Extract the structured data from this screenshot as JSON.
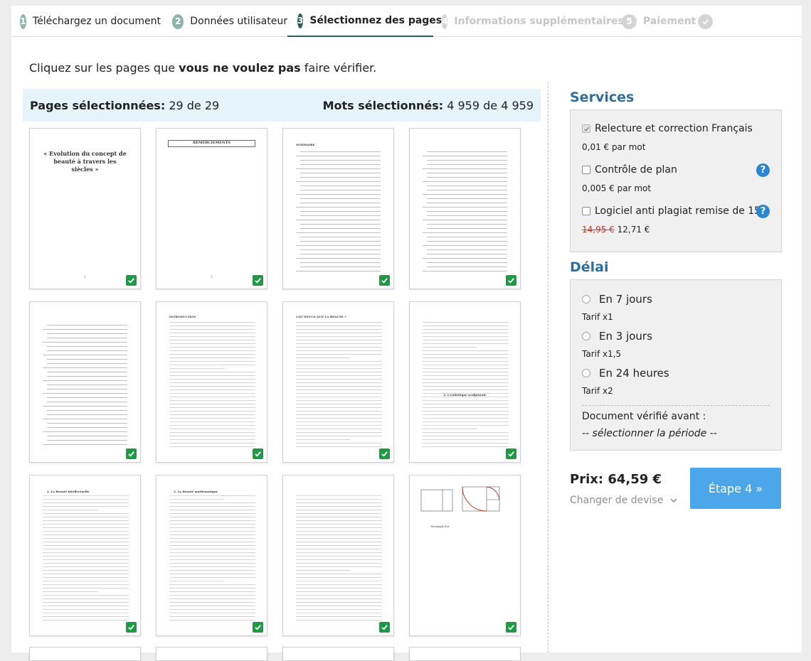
{
  "stepper": {
    "steps": [
      {
        "num": "1",
        "label": "Téléchargez un document"
      },
      {
        "num": "2",
        "label": "Données utilisateur"
      },
      {
        "num": "3",
        "label": "Sélectionnez des pages"
      },
      {
        "num": "4",
        "label": "Informations supplémentaires"
      },
      {
        "num": "5",
        "label": "Paiement"
      }
    ],
    "done_icon": "check-circle-icon"
  },
  "instruction": {
    "prefix": "Cliquez sur les pages que ",
    "bold": "vous ne voulez pas",
    "suffix": " faire vérifier."
  },
  "summary": {
    "pages_label": "Pages sélectionnées:",
    "pages_value": "29 de 29",
    "words_label": "Mots sélectionnés:",
    "words_value": "4 959 de 4 959"
  },
  "pages": {
    "cover_title": "« Evolution du concept de beauté à travers les siècles »",
    "p2_heading": "REMERCIEMENTS",
    "p3_heading": "SOMMAIRE",
    "p6_heading": "INTRODUCTION",
    "p7_heading": "I.QU'EST-CE QUE LA BEAUTE ?",
    "p8_heading": "2. L'esthétique sculpturale",
    "p9_heading": "2. La Beauté intellectuelle",
    "p10_heading": "3. La Beauté mathématique",
    "p12_caption": "Rectangle d'or",
    "all_selected": true
  },
  "services": {
    "title": "Services",
    "options": [
      {
        "label": "Relecture et correction Français",
        "price": "0,01 € par mot",
        "checked": true,
        "disabled": true
      },
      {
        "label": "Contrôle de plan",
        "price": "0,005 € par mot",
        "checked": false,
        "help": "?"
      },
      {
        "label": "Logiciel anti plagiat remise de 15%",
        "old_price": "14,95 €",
        "price": "12,71 €",
        "checked": false,
        "help": "?"
      }
    ]
  },
  "delay": {
    "title": "Délai",
    "options": [
      {
        "label": "En 7 jours",
        "rate": "Tarif x1"
      },
      {
        "label": "En 3 jours",
        "rate": "Tarif x1,5"
      },
      {
        "label": "En 24 heures",
        "rate": "Tarif x2"
      }
    ],
    "verified_label": "Document vérifié avant :",
    "verified_value": "-- sélectionner la période --"
  },
  "price": {
    "label": "Prix: 64,59 €",
    "currency_link": "Changer de devise"
  },
  "next_button": "Étape 4 »",
  "colors": {
    "accent": "#2c5e5a",
    "button": "#4ba7ea",
    "section_title": "#2f6e9d",
    "check": "#1f9a44",
    "summary_bg": "#e5f3fb"
  }
}
